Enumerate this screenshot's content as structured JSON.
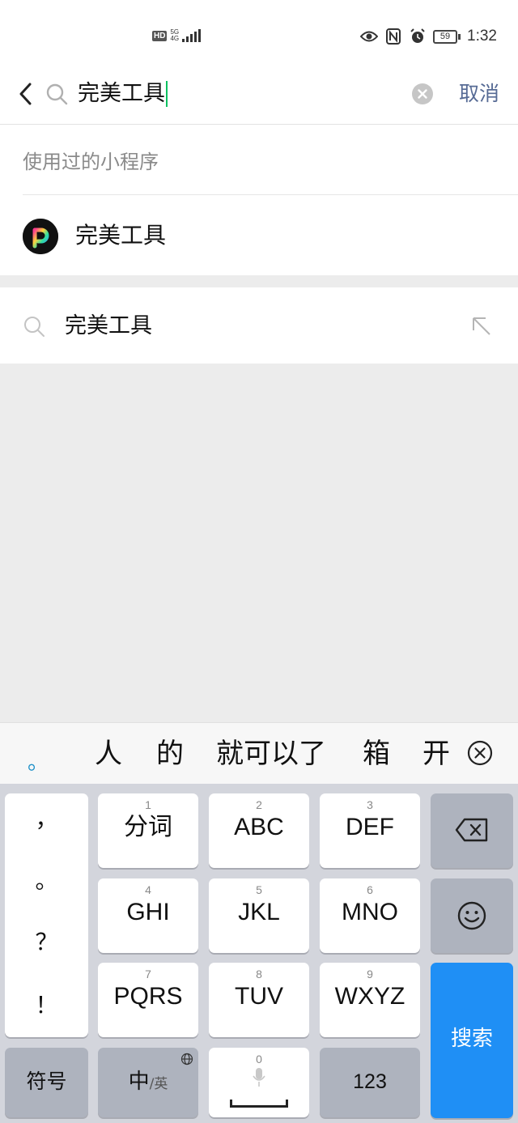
{
  "status_bar": {
    "left_badge": "HD",
    "network": "5G",
    "network_sub": "4G",
    "battery": "59",
    "time": "1:32"
  },
  "search": {
    "query": "完美工具",
    "cancel_label": "取消"
  },
  "used_section": {
    "title": "使用过的小程序",
    "items": [
      {
        "name": "完美工具"
      }
    ]
  },
  "suggestion": {
    "text": "完美工具"
  },
  "candidate_bar": {
    "first": "。",
    "words": [
      "人",
      "的",
      "就可以了",
      "箱",
      "开"
    ]
  },
  "keyboard": {
    "punctuation": [
      "，",
      "。",
      "？",
      "！"
    ],
    "keys": [
      {
        "num": "1",
        "label": "分词"
      },
      {
        "num": "2",
        "label": "ABC"
      },
      {
        "num": "3",
        "label": "DEF"
      },
      {
        "num": "4",
        "label": "GHI"
      },
      {
        "num": "5",
        "label": "JKL"
      },
      {
        "num": "6",
        "label": "MNO"
      },
      {
        "num": "7",
        "label": "PQRS"
      },
      {
        "num": "8",
        "label": "TUV"
      },
      {
        "num": "9",
        "label": "WXYZ"
      }
    ],
    "symbols_label": "符号",
    "lang_main": "中",
    "lang_sub": "/英",
    "space_num": "0",
    "numbers_label": "123",
    "search_label": "搜索"
  },
  "icons": [
    "back-icon",
    "search-icon",
    "clear-icon",
    "mini-program-logo",
    "suggest-arrow-icon",
    "candidate-close-icon",
    "backspace-icon",
    "emoji-icon",
    "globe-icon",
    "mic-icon",
    "eye-icon",
    "nfc-icon",
    "alarm-icon"
  ],
  "colors": {
    "accent_link": "#576b95",
    "caret": "#07c160",
    "search_key": "#1f8ff5"
  }
}
